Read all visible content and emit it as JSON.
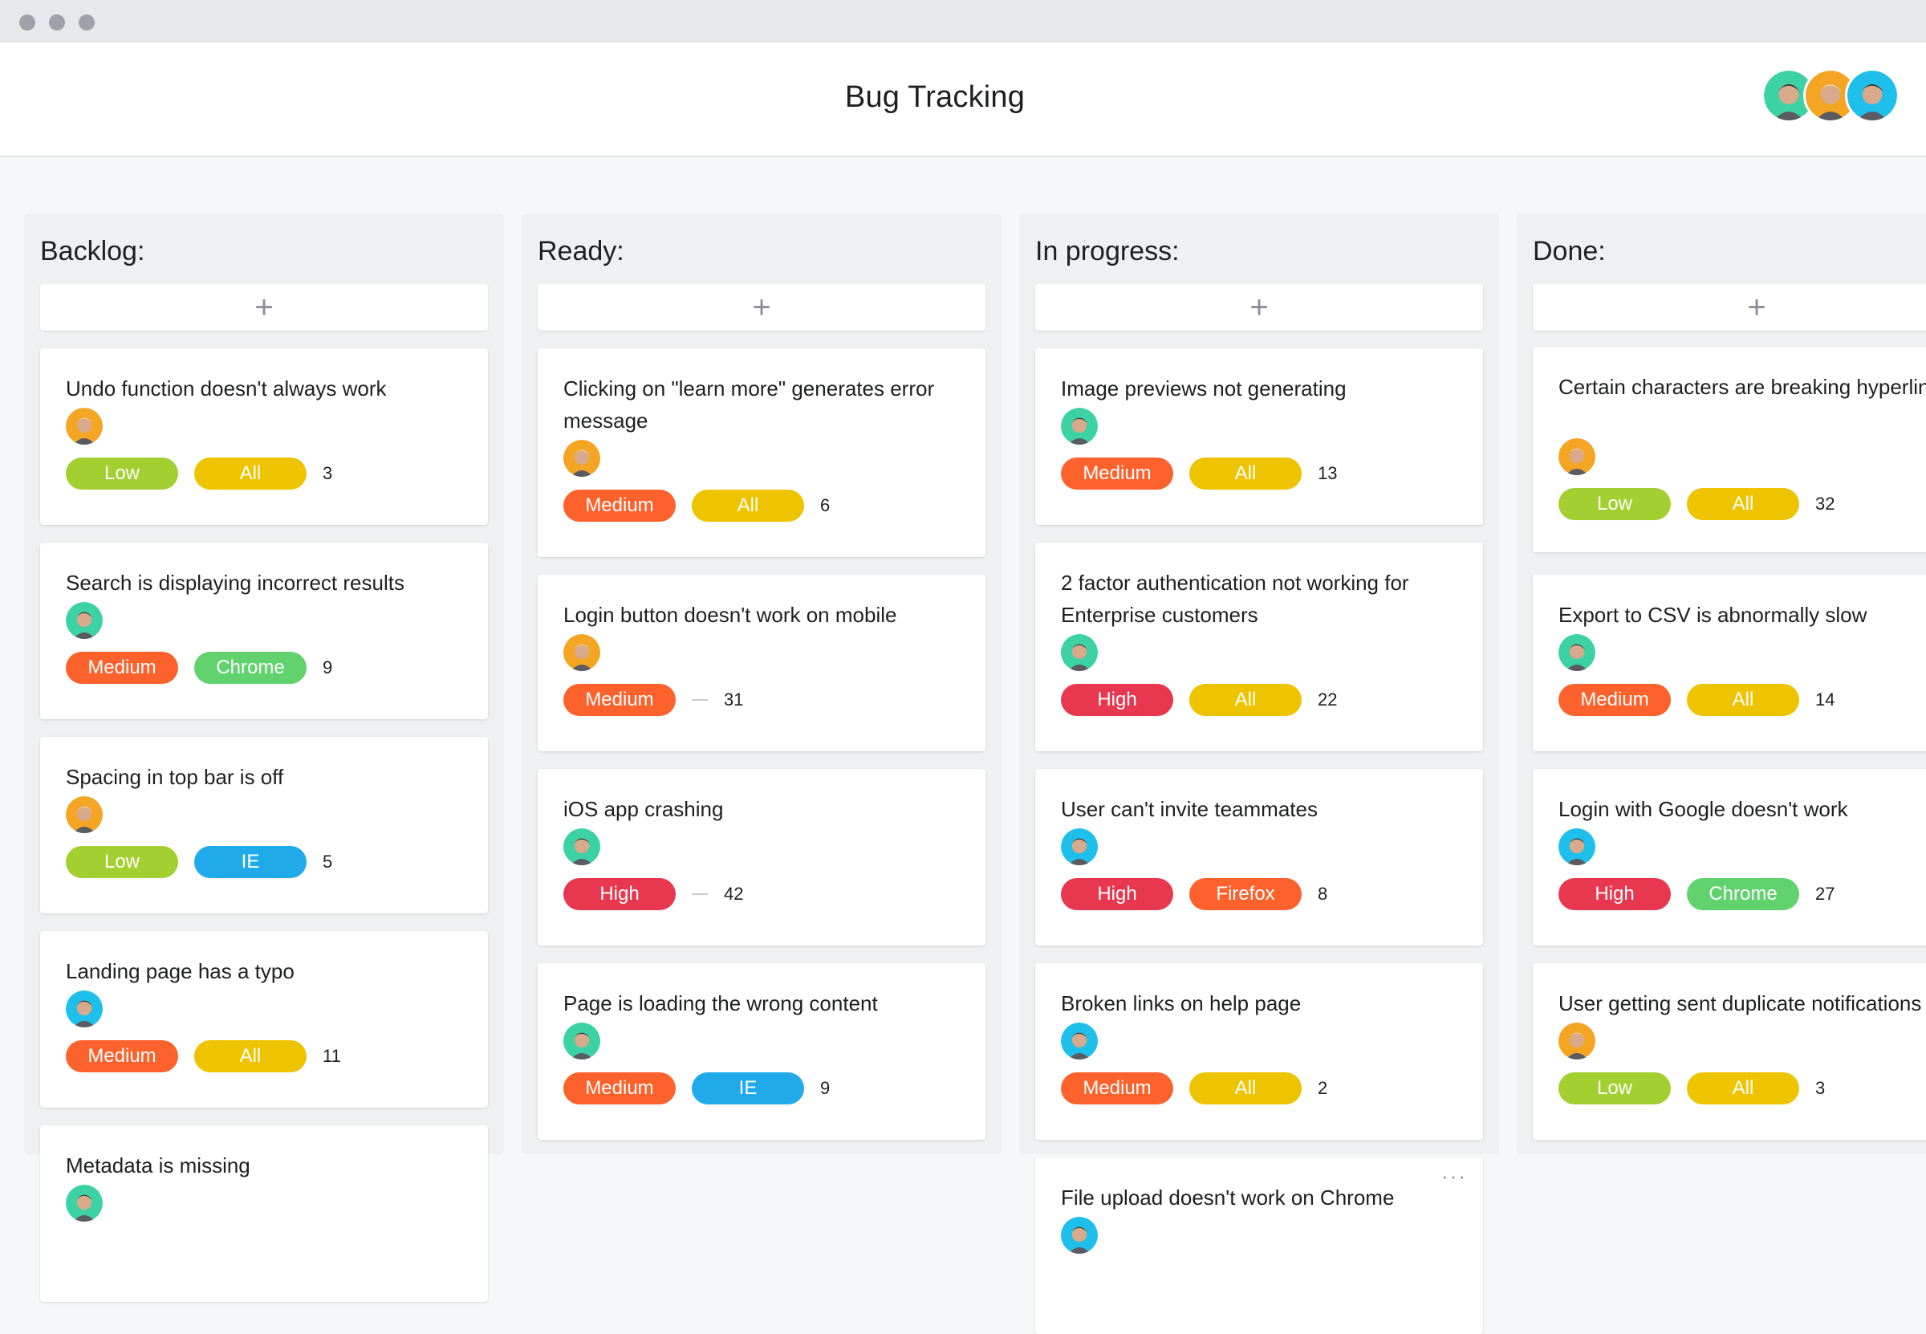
{
  "app": {
    "title": "Bug Tracking"
  },
  "colors": {
    "Low": "#a4cf30",
    "Medium": "#fd612c",
    "High": "#e8384f",
    "All": "#eec300",
    "Chrome": "#62d26f",
    "IE": "#20aaea",
    "Firefox": "#fd612c",
    "avatar_green": "#3dd2a4",
    "avatar_orange": "#f5a524",
    "avatar_blue": "#1ebfea"
  },
  "people": [
    "avatar_green",
    "avatar_orange",
    "avatar_blue"
  ],
  "add_label": "+",
  "columns": [
    {
      "title": "Backlog:",
      "cards": [
        {
          "title": "Undo function doesn't always work",
          "avatar": "avatar_orange",
          "priority": "Low",
          "browser": "All",
          "count": "3"
        },
        {
          "title": "Search is displaying incorrect results",
          "avatar": "avatar_green",
          "priority": "Medium",
          "browser": "Chrome",
          "count": "9"
        },
        {
          "title": "Spacing in top bar is off",
          "avatar": "avatar_orange",
          "priority": "Low",
          "browser": "IE",
          "count": "5"
        },
        {
          "title": "Landing page has a typo",
          "avatar": "avatar_blue",
          "priority": "Medium",
          "browser": "All",
          "count": "11"
        },
        {
          "title": "Metadata is missing",
          "avatar": "avatar_green",
          "priority": "",
          "browser": "",
          "count": ""
        }
      ]
    },
    {
      "title": "Ready:",
      "cards": [
        {
          "title": "Clicking on \"learn more\" generates error message",
          "avatar": "avatar_orange",
          "priority": "Medium",
          "browser": "All",
          "count": "6"
        },
        {
          "title": "Login button doesn't work on mobile",
          "avatar": "avatar_orange",
          "priority": "Medium",
          "browser": "",
          "count": "31"
        },
        {
          "title": "iOS app crashing",
          "avatar": "avatar_green",
          "priority": "High",
          "browser": "",
          "count": "42"
        },
        {
          "title": "Page is loading the wrong content",
          "avatar": "avatar_green",
          "priority": "Medium",
          "browser": "IE",
          "count": "9"
        }
      ]
    },
    {
      "title": "In progress:",
      "cards": [
        {
          "title": "Image previews not generating",
          "avatar": "avatar_green",
          "priority": "Medium",
          "browser": "All",
          "count": "13"
        },
        {
          "title": "2 factor authentication not working for Enterprise customers",
          "avatar": "avatar_green",
          "priority": "High",
          "browser": "All",
          "count": "22"
        },
        {
          "title": "User can't invite teammates",
          "avatar": "avatar_blue",
          "priority": "High",
          "browser": "Firefox",
          "count": "8"
        },
        {
          "title": "Broken links on help page",
          "avatar": "avatar_blue",
          "priority": "Medium",
          "browser": "All",
          "count": "2"
        },
        {
          "title": "File upload doesn't work on Chrome",
          "avatar": "avatar_blue",
          "priority": "",
          "browser": "",
          "count": "",
          "more": "···"
        }
      ]
    },
    {
      "title": "Done:",
      "cards": [
        {
          "title": "Certain characters are breaking hyperlinks",
          "avatar": "avatar_orange",
          "priority": "Low",
          "browser": "All",
          "count": "32"
        },
        {
          "title": "Export to CSV is abnormally slow",
          "avatar": "avatar_green",
          "priority": "Medium",
          "browser": "All",
          "count": "14"
        },
        {
          "title": "Login with Google doesn't work",
          "avatar": "avatar_blue",
          "priority": "High",
          "browser": "Chrome",
          "count": "27"
        },
        {
          "title": "User getting sent duplicate notifications",
          "avatar": "avatar_orange",
          "priority": "Low",
          "browser": "All",
          "count": "3"
        }
      ]
    }
  ]
}
